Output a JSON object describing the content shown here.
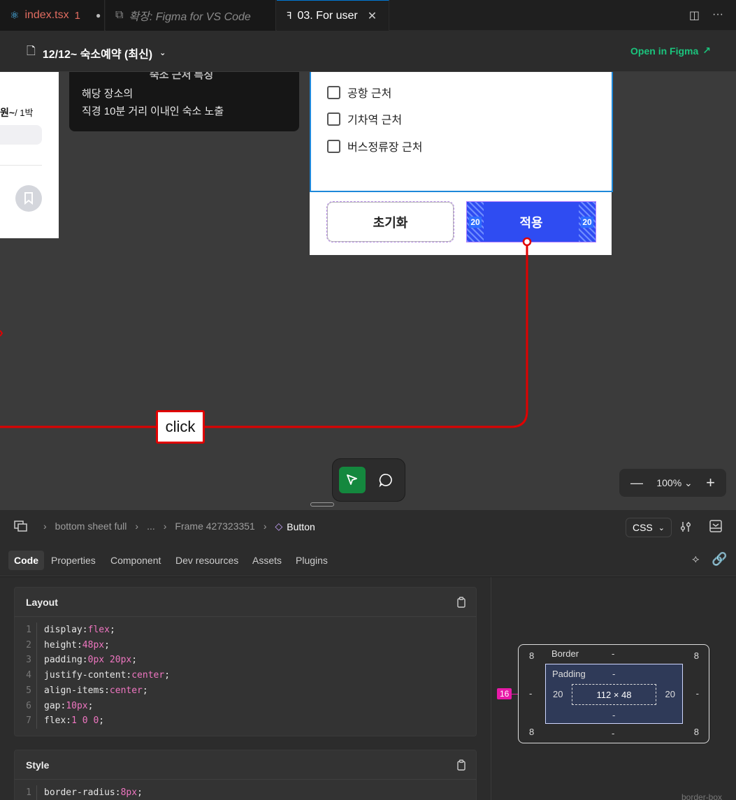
{
  "tabs": [
    {
      "label": "index.tsx",
      "modified_count": "1"
    },
    {
      "label": "확장: Figma for VS Code"
    },
    {
      "label": "03. For user"
    }
  ],
  "header": {
    "doc_title": "12/12~ 숙소예약 (최신)",
    "open_in_figma": "Open in Figma"
  },
  "canvas": {
    "card_price": "원~",
    "card_price_unit": "/ 1박",
    "tooltip_title": "숙소 근처 특징",
    "tooltip_line1": "해당 장소의",
    "tooltip_line2": "직경 10분 거리 이내인 숙소 노출",
    "checkboxes": [
      "공항 근처",
      "기차역 근처",
      "버스정류장 근처"
    ],
    "reset_button": "초기화",
    "apply_button": "적용",
    "padding_left": "20",
    "padding_right": "20",
    "prototype_label": "click",
    "zoom_level": "100%"
  },
  "breadcrumb": {
    "items": [
      "bottom sheet full",
      "...",
      "Frame 427323351"
    ],
    "current": "Button",
    "language": "CSS"
  },
  "panel_tabs": [
    "Code",
    "Properties",
    "Component",
    "Dev resources",
    "Assets",
    "Plugins"
  ],
  "layout": {
    "title": "Layout",
    "lines": [
      {
        "n": "1",
        "prop": "display",
        "val": "flex"
      },
      {
        "n": "2",
        "prop": "height",
        "val": "48px"
      },
      {
        "n": "3",
        "prop": "padding",
        "val": "0px 20px"
      },
      {
        "n": "4",
        "prop": "justify-content",
        "val": "center"
      },
      {
        "n": "5",
        "prop": "align-items",
        "val": "center"
      },
      {
        "n": "6",
        "prop": "gap",
        "val": "10px"
      },
      {
        "n": "7",
        "prop": "flex",
        "val": "1 0 0"
      }
    ]
  },
  "style": {
    "title": "Style",
    "lines": [
      {
        "n": "1",
        "prop": "border-radius",
        "val": "8px"
      }
    ]
  },
  "box_model": {
    "border_label": "Border",
    "padding_label": "Padding",
    "radius_tl": "8",
    "radius_tr": "8",
    "radius_bl": "8",
    "radius_br": "8",
    "border_top": "-",
    "border_bottom": "-",
    "border_left": "-",
    "border_right": "-",
    "padding_top": "-",
    "padding_bottom": "-",
    "padding_left": "20",
    "padding_right": "20",
    "content_size": "112 × 48",
    "gap_badge": "16",
    "mode": "border-box"
  },
  "colors": {
    "accent_green": "#1bc47d",
    "apply_blue": "#2f4cf2",
    "prototype_red": "#e00000",
    "code_value": "#ef76c1"
  }
}
